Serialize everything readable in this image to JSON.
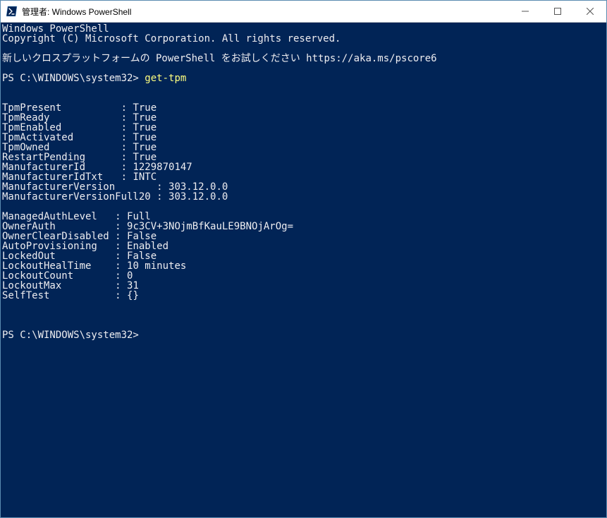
{
  "titlebar": {
    "title": "管理者: Windows PowerShell"
  },
  "header": {
    "line1": "Windows PowerShell",
    "line2": "Copyright (C) Microsoft Corporation. All rights reserved.",
    "line3": "新しいクロスプラットフォームの PowerShell をお試しください https://aka.ms/pscore6"
  },
  "prompt1": {
    "path": "PS C:\\WINDOWS\\system32> ",
    "command": "get-tpm"
  },
  "group1": {
    "TpmPresent": {
      "label": "TpmPresent",
      "sep": "          : ",
      "value": "True"
    },
    "TpmReady": {
      "label": "TpmReady",
      "sep": "            : ",
      "value": "True"
    },
    "TpmEnabled": {
      "label": "TpmEnabled",
      "sep": "          : ",
      "value": "True"
    },
    "TpmActivated": {
      "label": "TpmActivated",
      "sep": "        : ",
      "value": "True"
    },
    "TpmOwned": {
      "label": "TpmOwned",
      "sep": "            : ",
      "value": "True"
    },
    "RestartPending": {
      "label": "RestartPending",
      "sep": "      : ",
      "value": "True"
    },
    "ManufacturerId": {
      "label": "ManufacturerId",
      "sep": "      : ",
      "value": "1229870147"
    },
    "ManufacturerIdTxt": {
      "label": "ManufacturerIdTxt",
      "sep": "   : ",
      "value": "INTC"
    },
    "ManufacturerVersion": {
      "label": "ManufacturerVersion",
      "sep": "       : ",
      "value": "303.12.0.0"
    },
    "ManufacturerVersionFull20": {
      "label": "ManufacturerVersionFull20",
      "sep": " : ",
      "value": "303.12.0.0"
    }
  },
  "group2": {
    "ManagedAuthLevel": {
      "label": "ManagedAuthLevel",
      "sep": "   : ",
      "value": "Full"
    },
    "OwnerAuth": {
      "label": "OwnerAuth",
      "sep": "          : ",
      "value": "9c3CV+3NOjmBfKauLE9BNOjArOg="
    },
    "OwnerClearDisabled": {
      "label": "OwnerClearDisabled",
      "sep": " : ",
      "value": "False"
    },
    "AutoProvisioning": {
      "label": "AutoProvisioning",
      "sep": "   : ",
      "value": "Enabled"
    },
    "LockedOut": {
      "label": "LockedOut",
      "sep": "          : ",
      "value": "False"
    },
    "LockoutHealTime": {
      "label": "LockoutHealTime",
      "sep": "    : ",
      "value": "10 minutes"
    },
    "LockoutCount": {
      "label": "LockoutCount",
      "sep": "       : ",
      "value": "0"
    },
    "LockoutMax": {
      "label": "LockoutMax",
      "sep": "         : ",
      "value": "31"
    },
    "SelfTest": {
      "label": "SelfTest",
      "sep": "           : ",
      "value": "{}"
    }
  },
  "prompt2": {
    "path": "PS C:\\WINDOWS\\system32>"
  }
}
